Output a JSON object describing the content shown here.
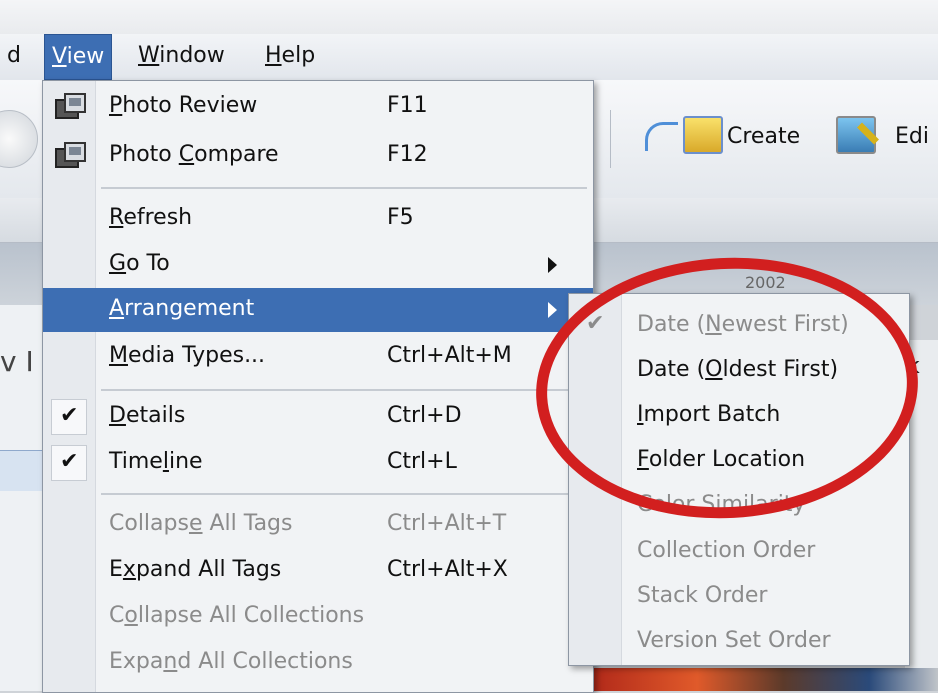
{
  "menubar": {
    "items": [
      {
        "label_pre": "",
        "label_u": "",
        "label_post": "d"
      },
      {
        "label_pre": "",
        "label_u": "V",
        "label_post": "iew"
      },
      {
        "label_pre": "",
        "label_u": "W",
        "label_post": "indow"
      },
      {
        "label_pre": "",
        "label_u": "H",
        "label_post": "elp"
      }
    ]
  },
  "toolbar": {
    "create_label": "Create",
    "edit_label": "Edi",
    "create_icon": "create-arrow-icon",
    "edit_icon": "edit-photo-icon"
  },
  "background": {
    "timeline_year": "2002",
    "left_fragment": "v I",
    "right_fragment": "k"
  },
  "view_menu": {
    "items": [
      {
        "pre": "",
        "u": "P",
        "post": "hoto Review",
        "shortcut": "F11",
        "icon": "photo-review-icon"
      },
      {
        "pre": "Photo ",
        "u": "C",
        "post": "ompare",
        "shortcut": "F12",
        "icon": "photo-compare-icon"
      },
      {
        "pre": "",
        "u": "R",
        "post": "efresh",
        "shortcut": "F5"
      },
      {
        "pre": "",
        "u": "G",
        "post": "o To",
        "shortcut": ""
      },
      {
        "pre": "",
        "u": "A",
        "post": "rrangement",
        "shortcut": ""
      },
      {
        "pre": "",
        "u": "M",
        "post": "edia Types...",
        "shortcut": "Ctrl+Alt+M"
      },
      {
        "pre": "",
        "u": "D",
        "post": "etails",
        "shortcut": "Ctrl+D",
        "checked": true
      },
      {
        "pre": "Time",
        "u": "l",
        "post": "ine",
        "shortcut": "Ctrl+L",
        "checked": true
      },
      {
        "pre": "Collaps",
        "u": "e",
        "post": " All Tags",
        "shortcut": "Ctrl+Alt+T",
        "disabled": true
      },
      {
        "pre": "E",
        "u": "x",
        "post": "pand All Tags",
        "shortcut": "Ctrl+Alt+X"
      },
      {
        "pre": "C",
        "u": "o",
        "post": "llapse All Collections",
        "shortcut": "",
        "disabled": true
      },
      {
        "pre": "Expa",
        "u": "n",
        "post": "d All Collections",
        "shortcut": "",
        "disabled": true
      }
    ],
    "check_glyph": "✔"
  },
  "arrangement_submenu": {
    "items": [
      {
        "pre": "Date (",
        "u": "N",
        "post": "ewest First)",
        "disabled": true,
        "checked": true
      },
      {
        "pre": "Date (",
        "u": "O",
        "post": "ldest First)"
      },
      {
        "pre": "",
        "u": "I",
        "post": "mport Batch"
      },
      {
        "pre": "",
        "u": "F",
        "post": "older Location"
      },
      {
        "pre": "Color Similarity",
        "u": "",
        "post": "",
        "disabled": true
      },
      {
        "pre": "Collection Order",
        "u": "",
        "post": "",
        "disabled": true
      },
      {
        "pre": "Stack Order",
        "u": "",
        "post": "",
        "disabled": true
      },
      {
        "pre": "Version Set Order",
        "u": "",
        "post": "",
        "disabled": true
      }
    ],
    "check_glyph": "✔"
  },
  "colors": {
    "highlight": "#3d6eb3",
    "annotation": "#d21f1f"
  }
}
